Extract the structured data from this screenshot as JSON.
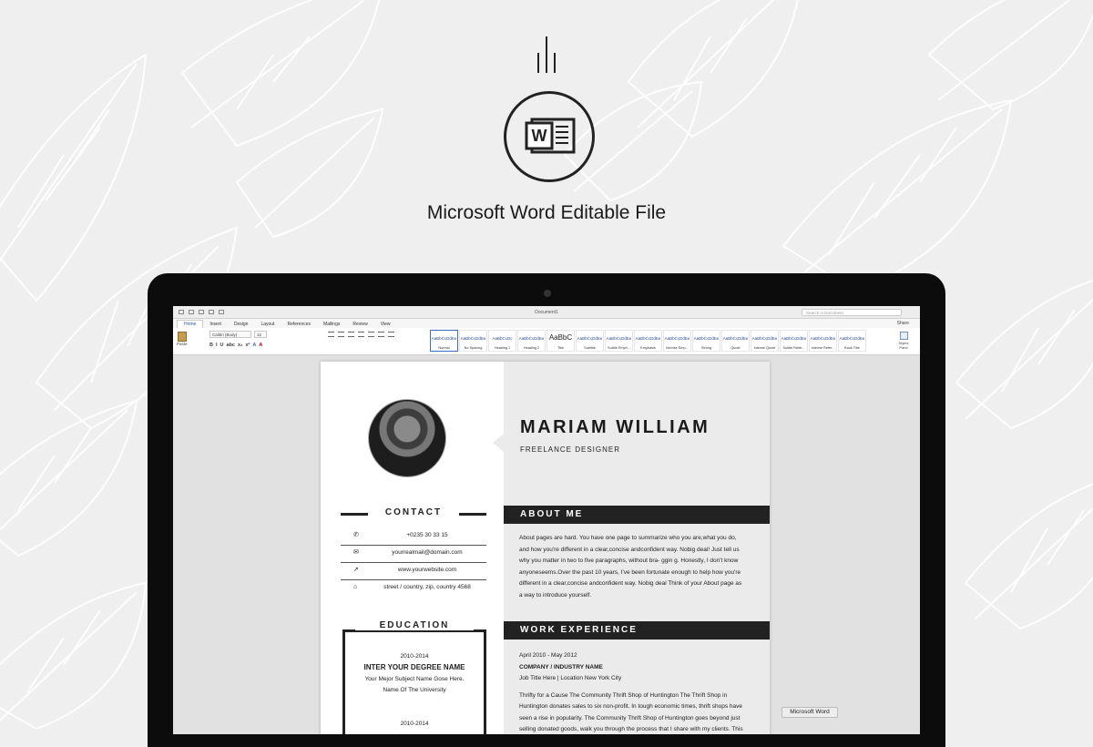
{
  "hero": {
    "headline": "Microsoft Word Editable File",
    "logo_letter": "W"
  },
  "word": {
    "document_title": "Document1",
    "search_placeholder": "Search in Document",
    "share_label": "Share",
    "tabs": [
      "Home",
      "Insert",
      "Design",
      "Layout",
      "References",
      "Mailings",
      "Review",
      "View"
    ],
    "paste_label": "Paste",
    "font_name": "Calibri (Body)",
    "font_size": "12",
    "format_buttons": [
      "B",
      "I",
      "U",
      "abc",
      "x₂",
      "x²",
      "A",
      "A"
    ],
    "styles": [
      {
        "sample": "AaBbCcDdEe",
        "name": "Normal"
      },
      {
        "sample": "AaBbCcDdEe",
        "name": "No Spacing"
      },
      {
        "sample": "AaBbCcDc",
        "name": "Heading 1"
      },
      {
        "sample": "AaBbCcDdEe",
        "name": "Heading 2"
      },
      {
        "sample": "AaBbC",
        "name": "Title"
      },
      {
        "sample": "AaBbCcDdEe",
        "name": "Subtitle"
      },
      {
        "sample": "AaBbCcDdEe",
        "name": "Subtle Emph..."
      },
      {
        "sample": "AaBbCcDdEe",
        "name": "Emphasis"
      },
      {
        "sample": "AaBbCcDdEe",
        "name": "Intense Emp..."
      },
      {
        "sample": "AaBbCcDdEe",
        "name": "Strong"
      },
      {
        "sample": "AaBbCcDdEe",
        "name": "Quote"
      },
      {
        "sample": "AaBbCcDdEe",
        "name": "Intense Quote"
      },
      {
        "sample": "AaBbCcDdEe",
        "name": "Subtle Refer..."
      },
      {
        "sample": "AaBbCcDdEe",
        "name": "Intense Refer..."
      },
      {
        "sample": "AaBbCcDdEe",
        "name": "Book Title"
      }
    ],
    "styles_pane_label": "Styles Pane",
    "dock_tooltip": "Microsoft Word"
  },
  "resume": {
    "name": "MARIAM WILLIAM",
    "role": "FREELANCE DESIGNER",
    "contact_heading": "CONTACT",
    "contact": [
      {
        "icon": "phone-icon",
        "glyph": "✆",
        "text": "+0235 30 33 15"
      },
      {
        "icon": "email-icon",
        "glyph": "✉",
        "text": "yourrealmail@domain.com"
      },
      {
        "icon": "cursor-icon",
        "glyph": "➚",
        "text": "www.yourwebsite.com"
      },
      {
        "icon": "home-icon",
        "glyph": "⌂",
        "text": "street / country, zip, country 4568"
      }
    ],
    "about_heading": "ABOUT ME",
    "about_lines": [
      "About pages are hard. You have one page to summarize who you are,what you do,",
      "and how you're different in a clear,concise andconfident way. Nobig deal! Just tell us",
      "why you matter in two to five paragraphs, without bra- ggin g. Honestly, I don't know",
      "anyoneseems.Over the past 10 years, I've been fortunate enough to help how you're",
      "different in a clear,concise andconfident way. Nobig deal Think of your About page as",
      "a way to introduce yourself."
    ],
    "work_heading": "WORK EXPERIENCE",
    "work": {
      "dates": "April 2010 - May 2012",
      "company": "COMPANY / INDUSTRY NAME",
      "title_location": "Job Title Here | Location New York City",
      "description_lines": [
        "Thrifty for a Cause The Community Thrift Shop of Huntington The Thrift Shop in",
        "Huntington donates sales to six non-profit. In tough economic times, thrift shops have",
        "seen a rise in popularity. The Community Thrift Shop of Huntington goes beyond just",
        "selling donated goods, walk you through the process that I share with my clients. This"
      ]
    },
    "education_heading": "EDUCATION",
    "education": [
      {
        "years": "2010-2014",
        "degree": "INTER YOUR DEGREE NAME",
        "subject": "Your Mejor Subject Name Gose Here.",
        "school": "Name Of The University"
      },
      {
        "years": "2010-2014"
      }
    ]
  }
}
